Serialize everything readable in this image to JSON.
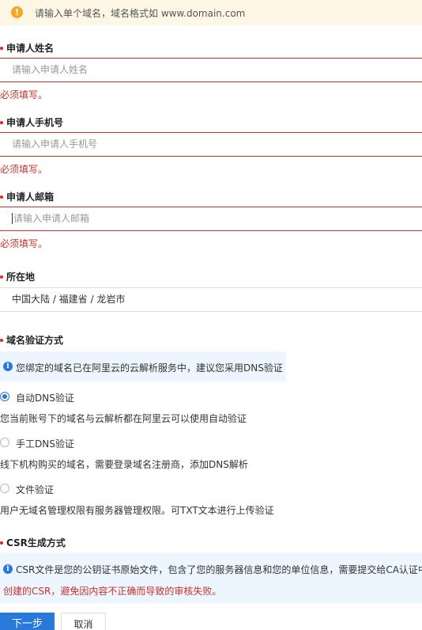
{
  "banner": {
    "text": "请输入单个域名，域名格式如 www.domain.com"
  },
  "fields": {
    "name": {
      "label": "申请人姓名",
      "placeholder": "请输入申请人姓名",
      "error": "必须填写。"
    },
    "phone": {
      "label": "申请人手机号",
      "placeholder": "请输入申请人手机号",
      "error": "必须填写。"
    },
    "email": {
      "label": "申请人邮箱",
      "placeholder": "请输入申请人邮箱",
      "error": "必须填写。"
    },
    "location": {
      "label": "所在地",
      "value": "中国大陆 / 福建省 / 龙岩市"
    }
  },
  "verify": {
    "label": "域名验证方式",
    "info": "您绑定的域名已在阿里云的云解析服务中，建议您采用DNS验证",
    "options": [
      {
        "label": "自动DNS验证",
        "desc": "您当前账号下的域名与云解析都在阿里云可以使用自动验证",
        "checked": true
      },
      {
        "label": "手工DNS验证",
        "desc": "线下机构购买的域名，需要登录域名注册商，添加DNS解析",
        "checked": false
      },
      {
        "label": "文件验证",
        "desc": "用户无域名管理权限有服务器管理权限。可TXT文本进行上传验证",
        "checked": false
      }
    ]
  },
  "csr": {
    "label": "CSR生成方式",
    "info_line1": "CSR文件是您的公钥证书原始文件，包含了您的服务器信息和您的单位信息，需要提交给CA认证中",
    "info_line2": "创建的CSR，避免因内容不正确而导致的审核失败。"
  },
  "buttons": {
    "next": "下一步",
    "cancel": "取消"
  }
}
